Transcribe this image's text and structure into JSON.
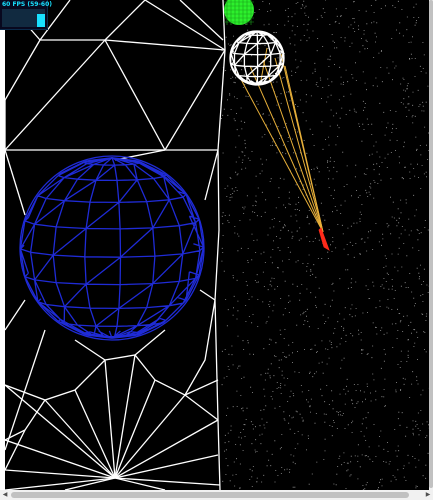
{
  "stats": {
    "fps_text": "60 FPS (59-60)",
    "fps_level": 0.75,
    "accent_color": "#19e0ff"
  },
  "scene": {
    "background": "#000000",
    "objects": [
      {
        "name": "blue-wireframe-planet",
        "color": "#1f2bd6"
      },
      {
        "name": "white-wireframe-planet",
        "color": "#ffffff"
      },
      {
        "name": "green-planet",
        "color": "#2cf02c"
      },
      {
        "name": "red-spaceship",
        "color": "#ff2a1a"
      },
      {
        "name": "orange-trajectory-lines",
        "color": "#e8b03a"
      },
      {
        "name": "white-terrain-mesh",
        "color": "#ffffff"
      }
    ]
  },
  "scrollbars": {
    "left_arrow": "◀",
    "right_arrow": "▶"
  }
}
